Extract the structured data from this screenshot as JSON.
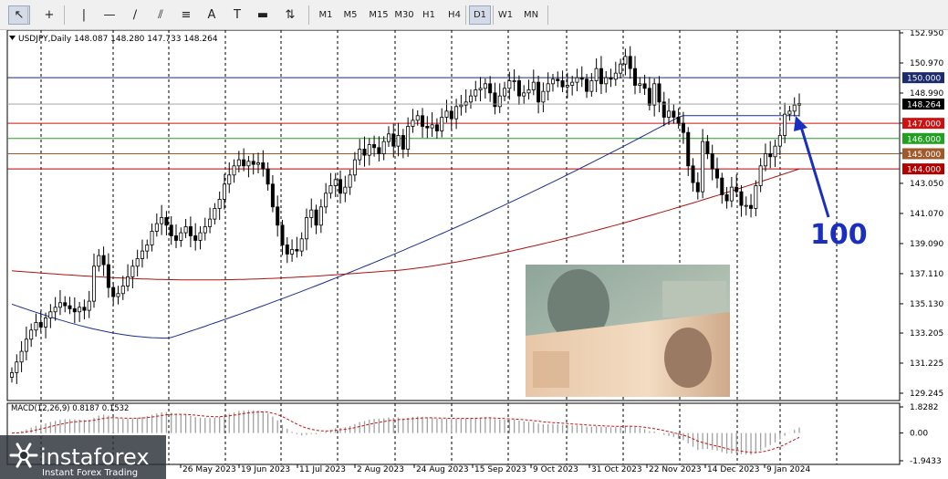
{
  "toolbar": {
    "tools": [
      {
        "name": "cursor-tool",
        "icon": "cursor-arrow-icon",
        "glyph": "↖"
      },
      {
        "name": "crosshair-tool",
        "icon": "crosshair-icon",
        "glyph": "+"
      },
      {
        "name": "vertical-line-tool",
        "icon": "vertical-line-icon",
        "glyph": "|"
      },
      {
        "name": "horizontal-line-tool",
        "icon": "horizontal-line-icon",
        "glyph": "—"
      },
      {
        "name": "trendline-tool",
        "icon": "trendline-icon",
        "glyph": "∕"
      },
      {
        "name": "equidistant-channel-tool",
        "icon": "channel-icon",
        "glyph": "⫽"
      },
      {
        "name": "fibonacci-tool",
        "icon": "fibonacci-icon",
        "glyph": "≡"
      },
      {
        "name": "text-tool",
        "icon": "text-icon",
        "glyph": "A"
      },
      {
        "name": "text-label-tool",
        "icon": "text-label-icon",
        "glyph": "T"
      },
      {
        "name": "rectangle-tool",
        "icon": "rectangle-icon",
        "glyph": "▬"
      },
      {
        "name": "arrows-tool",
        "icon": "arrows-icon",
        "glyph": "⇅"
      }
    ],
    "timeframes": [
      "M1",
      "M5",
      "M15",
      "M30",
      "H1",
      "H4",
      "D1",
      "W1",
      "MN"
    ],
    "active_timeframe": "D1"
  },
  "chart_data": {
    "type": "candlestick",
    "header": "USDJPY,Daily  148.087 148.280 147.733 148.264",
    "symbol_label": "USDJPY,Daily",
    "ohlc_text": "148.087 148.280 147.733 148.264",
    "price_ticks": [
      "152.950",
      "150.970",
      "148.990",
      "147.010",
      "145.030",
      "143.050",
      "141.070",
      "139.090",
      "137.110",
      "135.130",
      "133.205",
      "131.225",
      "129.245"
    ],
    "ylim": [
      129.245,
      152.95
    ],
    "current_price": {
      "value": 148.264,
      "label": "148.264"
    },
    "levels": [
      {
        "value": 150.0,
        "label": "150.000",
        "color": "#1c2a6e"
      },
      {
        "value": 147.0,
        "label": "147.000",
        "color": "#cc1111"
      },
      {
        "value": 146.0,
        "label": "146.000",
        "color": "#22a022"
      },
      {
        "value": 145.0,
        "label": "145.000",
        "color": "#a05a2a"
      },
      {
        "value": 144.0,
        "label": "144.000",
        "color": "#b00000"
      }
    ],
    "x_labels": [
      "26 May 2023",
      "19 Jun 2023",
      "11 Jul 2023",
      "2 Aug 2023",
      "24 Aug 2023",
      "15 Sep 2023",
      "9 Oct 2023",
      "31 Oct 2023",
      "22 Nov 2023",
      "14 Dec 2023",
      "9 Jan 2024"
    ],
    "closes": [
      130.6,
      131.3,
      132.0,
      132.8,
      133.4,
      133.9,
      133.6,
      134.2,
      134.6,
      134.9,
      135.2,
      135.0,
      134.8,
      134.6,
      134.9,
      134.7,
      135.3,
      137.6,
      138.3,
      137.7,
      136.2,
      135.6,
      135.8,
      136.3,
      136.9,
      137.6,
      138.1,
      138.6,
      139.0,
      139.9,
      140.4,
      140.8,
      140.3,
      139.6,
      139.3,
      139.8,
      140.2,
      139.6,
      139.3,
      139.8,
      140.2,
      140.7,
      141.4,
      142.0,
      143.0,
      143.6,
      144.2,
      144.6,
      144.2,
      144.5,
      144.3,
      144.4,
      144.0,
      143.0,
      141.5,
      140.3,
      139.0,
      138.4,
      138.7,
      138.6,
      139.4,
      140.8,
      141.3,
      140.3,
      141.5,
      142.4,
      142.9,
      143.3,
      142.4,
      142.8,
      143.6,
      144.6,
      145.3,
      144.9,
      145.6,
      145.4,
      145.0,
      145.8,
      146.3,
      145.5,
      146.2,
      145.3,
      146.8,
      147.2,
      147.5,
      146.8,
      146.7,
      146.9,
      146.5,
      147.4,
      147.8,
      147.3,
      148.1,
      148.2,
      148.4,
      148.8,
      149.2,
      149.3,
      149.6,
      149.0,
      148.1,
      148.8,
      149.3,
      149.8,
      149.8,
      148.8,
      149.0,
      149.2,
      149.7,
      148.4,
      149.1,
      149.6,
      149.9,
      149.8,
      149.4,
      149.5,
      149.7,
      150.0,
      149.9,
      149.1,
      149.8,
      150.6,
      149.6,
      150.0,
      149.9,
      150.3,
      150.9,
      151.4,
      150.6,
      149.5,
      149.6,
      149.3,
      148.2,
      149.6,
      148.4,
      147.4,
      147.8,
      147.4,
      147.0,
      146.4,
      144.2,
      143.1,
      142.5,
      145.8,
      145.0,
      144.0,
      143.4,
      142.3,
      141.9,
      142.8,
      142.5,
      141.6,
      141.6,
      141.4,
      142.9,
      144.2,
      145.0,
      144.8,
      145.5,
      146.2,
      147.6,
      147.8,
      148.2,
      148.3
    ],
    "sma_blue": {
      "start": 135.1,
      "end": 147.5
    },
    "sma_red": {
      "start": 137.3,
      "end": 144.0
    },
    "annotation": {
      "text": "100",
      "color": "#1a2fc0"
    },
    "macd": {
      "label": "MACD(12,26,9) 0.8187 0.1532",
      "ticks": [
        "1.8282",
        "0.00",
        "-1.9433"
      ],
      "ylim": [
        -1.9433,
        1.8282
      ]
    }
  },
  "branding": {
    "logo_text": "instaforex",
    "tagline": "Instant Forex Trading"
  },
  "colors": {
    "bull": "#000000",
    "bear": "#000000",
    "sma_blue": "#1d2e8f",
    "sma_red": "#b01010",
    "grid": "#000000",
    "annotation": "#1a2fc0"
  }
}
